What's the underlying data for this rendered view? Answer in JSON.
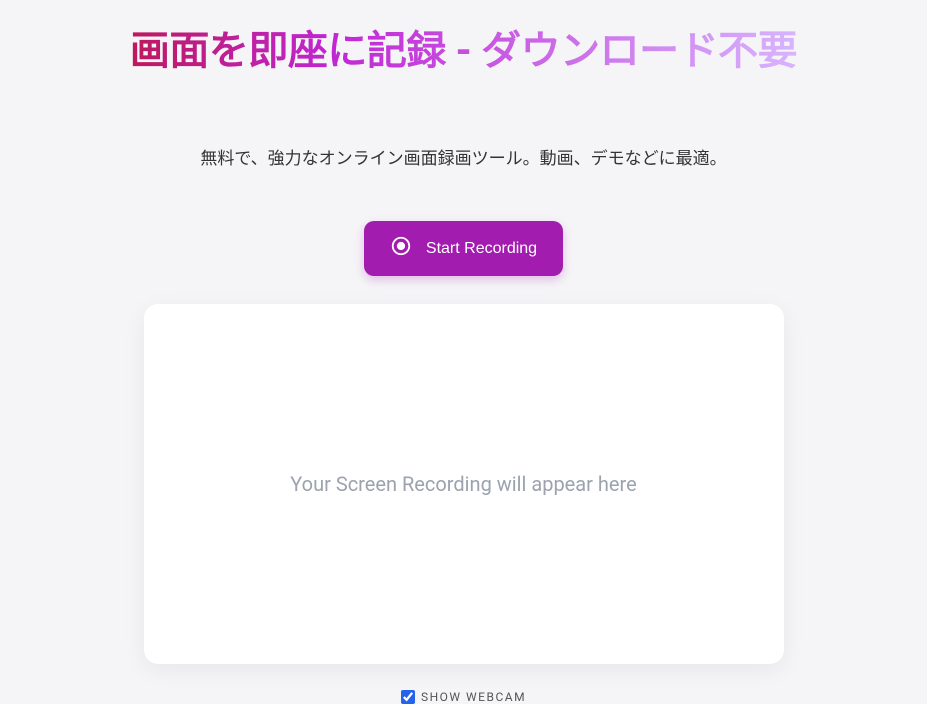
{
  "hero": {
    "title": "画面を即座に記録 - ダウンロード不要",
    "subtitle": "無料で、強力なオンライン画面録画ツール。動画、デモなどに最適。"
  },
  "actions": {
    "start_recording_label": "Start Recording"
  },
  "preview": {
    "placeholder_text": "Your Screen Recording will appear here"
  },
  "webcam": {
    "label": "SHOW WEBCAM",
    "checked": true
  }
}
